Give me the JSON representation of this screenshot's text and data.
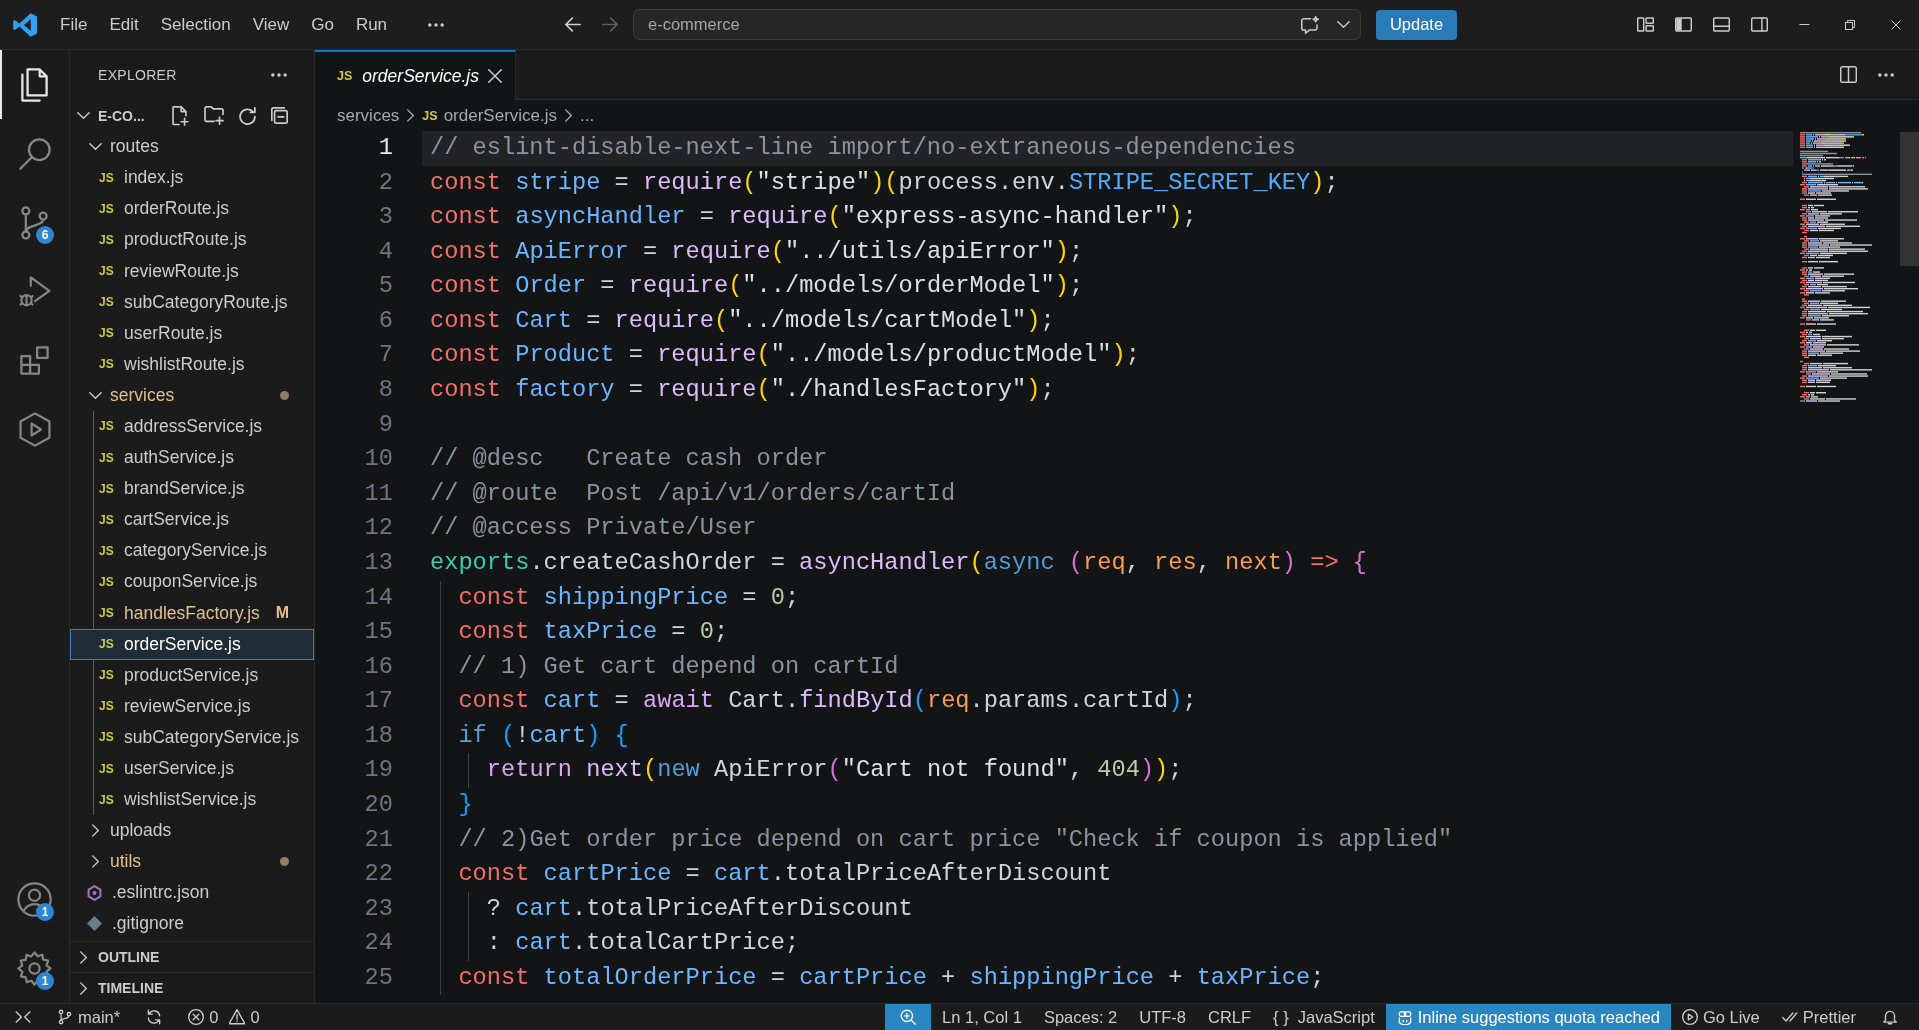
{
  "title_bar": {
    "menu": [
      "File",
      "Edit",
      "Selection",
      "View",
      "Go",
      "Run"
    ],
    "command_center": {
      "label": "e-commerce"
    },
    "update_button": {
      "label": "Update"
    }
  },
  "activity_bar": {
    "items": [
      {
        "kind": "explorer",
        "selected": true
      },
      {
        "kind": "search",
        "selected": false
      },
      {
        "kind": "source-control",
        "selected": false,
        "badge": "6"
      },
      {
        "kind": "run-debug",
        "selected": false
      },
      {
        "kind": "extensions",
        "selected": false
      },
      {
        "kind": "remote-explorer",
        "selected": false
      }
    ],
    "bottom": [
      {
        "kind": "accounts",
        "badge": "1"
      },
      {
        "kind": "manage",
        "badge": "1"
      }
    ]
  },
  "sidebar": {
    "title": "EXPLORER",
    "tree": [
      {
        "label": "E-CO...",
        "kind": "root",
        "expanded": true,
        "selected": false,
        "modified": false,
        "children": [
          {
            "label": "routes",
            "kind": "folder",
            "expanded": true,
            "selected": false,
            "modified": false,
            "children": [
              {
                "label": "index.js",
                "kind": "js-file",
                "icon": "JS",
                "selected": false,
                "modified": false
              },
              {
                "label": "orderRoute.js",
                "kind": "js-file",
                "icon": "JS",
                "selected": false,
                "modified": false
              },
              {
                "label": "productRoute.js",
                "kind": "js-file",
                "icon": "JS",
                "selected": false,
                "modified": false
              },
              {
                "label": "reviewRoute.js",
                "kind": "js-file",
                "icon": "JS",
                "selected": false,
                "modified": false
              },
              {
                "label": "subCategoryRoute.js",
                "kind": "js-file",
                "icon": "JS",
                "selected": false,
                "modified": false
              },
              {
                "label": "userRoute.js",
                "kind": "js-file",
                "icon": "JS",
                "selected": false,
                "modified": false
              },
              {
                "label": "wishlistRoute.js",
                "kind": "js-file",
                "icon": "JS",
                "selected": false,
                "modified": false
              }
            ]
          },
          {
            "label": "services",
            "kind": "folder",
            "expanded": true,
            "selected": false,
            "modified": true,
            "children": [
              {
                "label": "addressService.js",
                "kind": "js-file",
                "icon": "JS",
                "selected": false,
                "modified": false
              },
              {
                "label": "authService.js",
                "kind": "js-file",
                "icon": "JS",
                "selected": false,
                "modified": false
              },
              {
                "label": "brandService.js",
                "kind": "js-file",
                "icon": "JS",
                "selected": false,
                "modified": false
              },
              {
                "label": "cartService.js",
                "kind": "js-file",
                "icon": "JS",
                "selected": false,
                "modified": false
              },
              {
                "label": "categoryService.js",
                "kind": "js-file",
                "icon": "JS",
                "selected": false,
                "modified": false
              },
              {
                "label": "couponService.js",
                "kind": "js-file",
                "icon": "JS",
                "selected": false,
                "modified": false
              },
              {
                "label": "handlesFactory.js",
                "kind": "js-file",
                "icon": "JS",
                "selected": false,
                "modified": true,
                "badge": "M"
              },
              {
                "label": "orderService.js",
                "kind": "js-file",
                "icon": "JS",
                "selected": true,
                "modified": false
              },
              {
                "label": "productService.js",
                "kind": "js-file",
                "icon": "JS",
                "selected": false,
                "modified": false
              },
              {
                "label": "reviewService.js",
                "kind": "js-file",
                "icon": "JS",
                "selected": false,
                "modified": false
              },
              {
                "label": "subCategoryService.js",
                "kind": "js-file",
                "icon": "JS",
                "selected": false,
                "modified": false
              },
              {
                "label": "userService.js",
                "kind": "js-file",
                "icon": "JS",
                "selected": false,
                "modified": false
              },
              {
                "label": "wishlistService.js",
                "kind": "js-file",
                "icon": "JS",
                "selected": false,
                "modified": false
              }
            ]
          },
          {
            "label": "uploads",
            "kind": "folder",
            "expanded": false,
            "selected": false,
            "modified": false
          },
          {
            "label": "utils",
            "kind": "folder",
            "expanded": false,
            "selected": false,
            "modified": true
          },
          {
            "label": ".eslintrc.json",
            "kind": "eslint-file",
            "selected": false,
            "modified": false
          },
          {
            "label": ".gitignore",
            "kind": "git-file",
            "selected": false,
            "modified": false
          }
        ]
      }
    ],
    "panels": [
      {
        "title": "OUTLINE",
        "expanded": false
      },
      {
        "title": "TIMELINE",
        "expanded": false
      }
    ]
  },
  "editor": {
    "tabs": [
      {
        "label": "orderService.js",
        "icon": "JS",
        "selected": true,
        "preview": true
      }
    ],
    "breadcrumb": [
      {
        "label": "services"
      },
      {
        "label": "orderService.js",
        "icon": "JS"
      },
      {
        "label": "..."
      }
    ],
    "lines": [
      {
        "number": "1",
        "current": true,
        "tokens": [
          {
            "kind": "comment",
            "text": "// eslint-disable-next-line import/no-extraneous-dependencies"
          }
        ]
      },
      {
        "number": "2",
        "current": false,
        "tokens": [
          {
            "kind": "storage",
            "text": "const "
          },
          {
            "kind": "variable",
            "text": "stripe"
          },
          {
            "kind": "plain",
            "text": " = "
          },
          {
            "kind": "function",
            "text": "require"
          },
          {
            "kind": "bracket1",
            "text": "("
          },
          {
            "kind": "string",
            "text": "\"stripe\""
          },
          {
            "kind": "bracket1",
            "text": ")("
          },
          {
            "kind": "plain",
            "text": "process.env."
          },
          {
            "kind": "constant",
            "text": "STRIPE_SECRET_KEY"
          },
          {
            "kind": "bracket1",
            "text": ")"
          },
          {
            "kind": "plain",
            "text": ";"
          }
        ]
      },
      {
        "number": "3",
        "current": false,
        "tokens": [
          {
            "kind": "storage",
            "text": "const "
          },
          {
            "kind": "variable",
            "text": "asyncHandler"
          },
          {
            "kind": "plain",
            "text": " = "
          },
          {
            "kind": "function",
            "text": "require"
          },
          {
            "kind": "bracket1",
            "text": "("
          },
          {
            "kind": "string",
            "text": "\"express-async-handler\""
          },
          {
            "kind": "bracket1",
            "text": ")"
          },
          {
            "kind": "plain",
            "text": ";"
          }
        ]
      },
      {
        "number": "4",
        "current": false,
        "tokens": [
          {
            "kind": "storage",
            "text": "const "
          },
          {
            "kind": "variable",
            "text": "ApiError"
          },
          {
            "kind": "plain",
            "text": " = "
          },
          {
            "kind": "function",
            "text": "require"
          },
          {
            "kind": "bracket1",
            "text": "("
          },
          {
            "kind": "string",
            "text": "\"../utils/apiError\""
          },
          {
            "kind": "bracket1",
            "text": ")"
          },
          {
            "kind": "plain",
            "text": ";"
          }
        ]
      },
      {
        "number": "5",
        "current": false,
        "tokens": [
          {
            "kind": "storage",
            "text": "const "
          },
          {
            "kind": "variable",
            "text": "Order"
          },
          {
            "kind": "plain",
            "text": " = "
          },
          {
            "kind": "function",
            "text": "require"
          },
          {
            "kind": "bracket1",
            "text": "("
          },
          {
            "kind": "string",
            "text": "\"../models/orderModel\""
          },
          {
            "kind": "bracket1",
            "text": ")"
          },
          {
            "kind": "plain",
            "text": ";"
          }
        ]
      },
      {
        "number": "6",
        "current": false,
        "tokens": [
          {
            "kind": "storage",
            "text": "const "
          },
          {
            "kind": "variable",
            "text": "Cart"
          },
          {
            "kind": "plain",
            "text": " = "
          },
          {
            "kind": "function",
            "text": "require"
          },
          {
            "kind": "bracket1",
            "text": "("
          },
          {
            "kind": "string",
            "text": "\"../models/cartModel\""
          },
          {
            "kind": "bracket1",
            "text": ")"
          },
          {
            "kind": "plain",
            "text": ";"
          }
        ]
      },
      {
        "number": "7",
        "current": false,
        "tokens": [
          {
            "kind": "storage",
            "text": "const "
          },
          {
            "kind": "variable",
            "text": "Product"
          },
          {
            "kind": "plain",
            "text": " = "
          },
          {
            "kind": "function",
            "text": "require"
          },
          {
            "kind": "bracket1",
            "text": "("
          },
          {
            "kind": "string",
            "text": "\"../models/productModel\""
          },
          {
            "kind": "bracket1",
            "text": ")"
          },
          {
            "kind": "plain",
            "text": ";"
          }
        ]
      },
      {
        "number": "8",
        "current": false,
        "tokens": [
          {
            "kind": "storage",
            "text": "const "
          },
          {
            "kind": "variable",
            "text": "factory"
          },
          {
            "kind": "plain",
            "text": " = "
          },
          {
            "kind": "function",
            "text": "require"
          },
          {
            "kind": "bracket1",
            "text": "("
          },
          {
            "kind": "string",
            "text": "\"./handlesFactory\""
          },
          {
            "kind": "bracket1",
            "text": ")"
          },
          {
            "kind": "plain",
            "text": ";"
          }
        ]
      },
      {
        "number": "9",
        "current": false
      },
      {
        "number": "10",
        "current": false,
        "tokens": [
          {
            "kind": "comment",
            "text": "// @desc   Create cash order"
          }
        ]
      },
      {
        "number": "11",
        "current": false,
        "tokens": [
          {
            "kind": "comment",
            "text": "// @route  Post /api/v1/orders/cartId"
          }
        ]
      },
      {
        "number": "12",
        "current": false,
        "tokens": [
          {
            "kind": "comment",
            "text": "// @access Private/User"
          }
        ]
      },
      {
        "number": "13",
        "current": false,
        "tokens": [
          {
            "kind": "support",
            "text": "exports"
          },
          {
            "kind": "plain",
            "text": ".createCashOrder = "
          },
          {
            "kind": "function",
            "text": "asyncHandler"
          },
          {
            "kind": "bracket1",
            "text": "("
          },
          {
            "kind": "keyword",
            "text": "async "
          },
          {
            "kind": "bracket2",
            "text": "("
          },
          {
            "kind": "param",
            "text": "req"
          },
          {
            "kind": "plain",
            "text": ", "
          },
          {
            "kind": "param",
            "text": "res"
          },
          {
            "kind": "plain",
            "text": ", "
          },
          {
            "kind": "param",
            "text": "next"
          },
          {
            "kind": "bracket2",
            "text": ")"
          },
          {
            "kind": "arrow",
            "text": " => "
          },
          {
            "kind": "bracket2",
            "text": "{"
          }
        ]
      },
      {
        "number": "14",
        "current": false,
        "tokens": [
          {
            "kind": "storage",
            "text": "  const "
          },
          {
            "kind": "variable",
            "text": "shippingPrice"
          },
          {
            "kind": "plain",
            "text": " = "
          },
          {
            "kind": "number",
            "text": "0"
          },
          {
            "kind": "plain",
            "text": ";"
          }
        ]
      },
      {
        "number": "15",
        "current": false,
        "tokens": [
          {
            "kind": "storage",
            "text": "  const "
          },
          {
            "kind": "variable",
            "text": "taxPrice"
          },
          {
            "kind": "plain",
            "text": " = "
          },
          {
            "kind": "number",
            "text": "0"
          },
          {
            "kind": "plain",
            "text": ";"
          }
        ]
      },
      {
        "number": "16",
        "current": false,
        "tokens": [
          {
            "kind": "comment",
            "text": "  // 1) Get cart depend on cartId"
          }
        ]
      },
      {
        "number": "17",
        "current": false,
        "tokens": [
          {
            "kind": "storage",
            "text": "  const "
          },
          {
            "kind": "variable",
            "text": "cart"
          },
          {
            "kind": "plain",
            "text": " = "
          },
          {
            "kind": "control",
            "text": "await "
          },
          {
            "kind": "plain",
            "text": "Cart."
          },
          {
            "kind": "function",
            "text": "findById"
          },
          {
            "kind": "bracket3",
            "text": "("
          },
          {
            "kind": "param",
            "text": "req"
          },
          {
            "kind": "plain",
            "text": ".params.cartId"
          },
          {
            "kind": "bracket3",
            "text": ")"
          },
          {
            "kind": "plain",
            "text": ";"
          }
        ]
      },
      {
        "number": "18",
        "current": false,
        "tokens": [
          {
            "kind": "keyword",
            "text": "  if "
          },
          {
            "kind": "bracket3",
            "text": "("
          },
          {
            "kind": "plain",
            "text": "!"
          },
          {
            "kind": "variable",
            "text": "cart"
          },
          {
            "kind": "bracket3",
            "text": ") {"
          }
        ]
      },
      {
        "number": "19",
        "current": false,
        "tokens": [
          {
            "kind": "control",
            "text": "    return "
          },
          {
            "kind": "function",
            "text": "next"
          },
          {
            "kind": "bracket1",
            "text": "("
          },
          {
            "kind": "keyword",
            "text": "new "
          },
          {
            "kind": "plain",
            "text": "ApiError"
          },
          {
            "kind": "bracket2",
            "text": "("
          },
          {
            "kind": "string",
            "text": "\"Cart not found\""
          },
          {
            "kind": "plain",
            "text": ", "
          },
          {
            "kind": "number",
            "text": "404"
          },
          {
            "kind": "bracket2",
            "text": ")"
          },
          {
            "kind": "bracket1",
            "text": ")"
          },
          {
            "kind": "plain",
            "text": ";"
          }
        ]
      },
      {
        "number": "20",
        "current": false,
        "tokens": [
          {
            "kind": "bracket3",
            "text": "  }"
          }
        ]
      },
      {
        "number": "21",
        "current": false,
        "tokens": [
          {
            "kind": "comment",
            "text": "  // 2)Get order price depend on cart price \"Check if coupon is applied\""
          }
        ]
      },
      {
        "number": "22",
        "current": false,
        "tokens": [
          {
            "kind": "storage",
            "text": "  const "
          },
          {
            "kind": "variable",
            "text": "cartPrice"
          },
          {
            "kind": "plain",
            "text": " = "
          },
          {
            "kind": "variable",
            "text": "cart"
          },
          {
            "kind": "plain",
            "text": ".totalPriceAfterDiscount"
          }
        ]
      },
      {
        "number": "23",
        "current": false,
        "tokens": [
          {
            "kind": "plain",
            "text": "    ? "
          },
          {
            "kind": "variable",
            "text": "cart"
          },
          {
            "kind": "plain",
            "text": ".totalPriceAfterDiscount"
          }
        ]
      },
      {
        "number": "24",
        "current": false,
        "tokens": [
          {
            "kind": "plain",
            "text": "    : "
          },
          {
            "kind": "variable",
            "text": "cart"
          },
          {
            "kind": "plain",
            "text": ".totalCartPrice;"
          }
        ]
      },
      {
        "number": "25",
        "current": false,
        "tokens": [
          {
            "kind": "storage",
            "text": "  const "
          },
          {
            "kind": "variable",
            "text": "totalOrderPrice"
          },
          {
            "kind": "plain",
            "text": " = "
          },
          {
            "kind": "variable",
            "text": "cartPrice"
          },
          {
            "kind": "plain",
            "text": " + "
          },
          {
            "kind": "variable",
            "text": "shippingPrice"
          },
          {
            "kind": "plain",
            "text": " + "
          },
          {
            "kind": "variable",
            "text": "taxPrice"
          },
          {
            "kind": "plain",
            "text": ";"
          }
        ]
      }
    ]
  },
  "status_bar": {
    "left": [
      {
        "kind": "remote",
        "prominent": false
      },
      {
        "kind": "branch",
        "text": "main*",
        "prominent": false
      },
      {
        "kind": "sync",
        "prominent": false
      },
      {
        "kind": "problems",
        "errors": "0",
        "warnings": "0",
        "prominent": false
      }
    ],
    "right": [
      {
        "kind": "zoom",
        "prominent": true
      },
      {
        "kind": "text",
        "text": "Ln 1, Col 1",
        "prominent": false
      },
      {
        "kind": "text",
        "text": "Spaces: 2",
        "prominent": false
      },
      {
        "kind": "text",
        "text": "UTF-8",
        "prominent": false
      },
      {
        "kind": "text",
        "text": "CRLF",
        "prominent": false
      },
      {
        "kind": "language",
        "icon": "{ }",
        "text": "JavaScript",
        "prominent": false
      },
      {
        "kind": "copilot",
        "text": "Inline suggestions quota reached",
        "prominent": true
      },
      {
        "kind": "live",
        "text": "Go Live",
        "prominent": false
      },
      {
        "kind": "prettier",
        "text": "Prettier",
        "prominent": false
      },
      {
        "kind": "notifications",
        "prominent": false
      }
    ]
  }
}
